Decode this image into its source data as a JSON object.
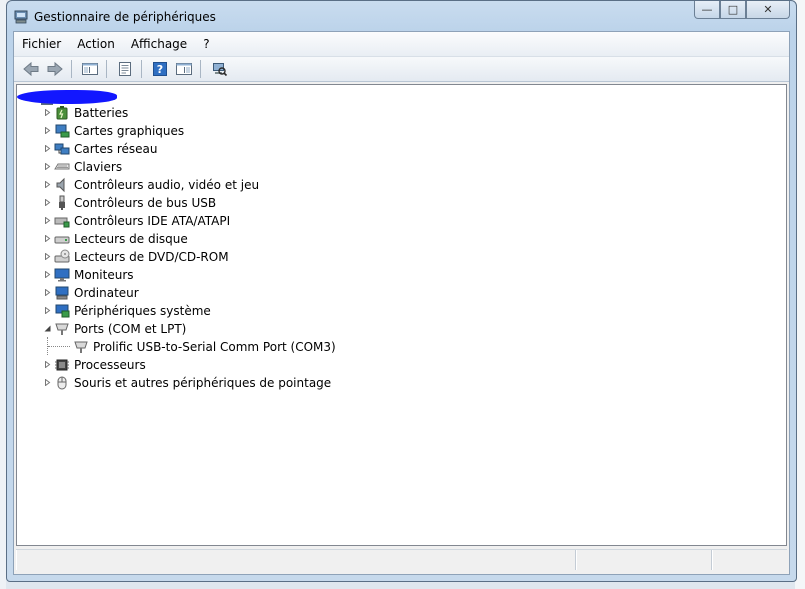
{
  "window": {
    "title": "Gestionnaire de périphériques",
    "minimize_glyph": "—",
    "maximize_glyph": "□",
    "close_glyph": "✕"
  },
  "menu": [
    "Fichier",
    "Action",
    "Affichage",
    "?"
  ],
  "toolbar": {
    "buttons": [
      "back-icon",
      "forward-icon",
      "show-hide-console-tree-icon",
      "properties-icon",
      "help-icon",
      "show-action-pane-icon",
      "scan-hardware-changes-icon"
    ]
  },
  "tree": {
    "nodes": [
      {
        "label": "Batteries",
        "icon": "battery-icon",
        "expanded": false
      },
      {
        "label": "Cartes graphiques",
        "icon": "display-adapter-icon",
        "expanded": false
      },
      {
        "label": "Cartes réseau",
        "icon": "network-adapter-icon",
        "expanded": false
      },
      {
        "label": "Claviers",
        "icon": "keyboard-icon",
        "expanded": false
      },
      {
        "label": "Contrôleurs audio, vidéo et jeu",
        "icon": "speaker-icon",
        "expanded": false
      },
      {
        "label": "Contrôleurs de bus USB",
        "icon": "usb-icon",
        "expanded": false
      },
      {
        "label": "Contrôleurs IDE ATA/ATAPI",
        "icon": "ide-controller-icon",
        "expanded": false
      },
      {
        "label": "Lecteurs de disque",
        "icon": "disk-drive-icon",
        "expanded": false
      },
      {
        "label": "Lecteurs de DVD/CD-ROM",
        "icon": "dvd-drive-icon",
        "expanded": false
      },
      {
        "label": "Moniteurs",
        "icon": "monitor-icon",
        "expanded": false
      },
      {
        "label": "Ordinateur",
        "icon": "computer-icon",
        "expanded": false
      },
      {
        "label": "Périphériques système",
        "icon": "system-device-icon",
        "expanded": false
      },
      {
        "label": "Ports (COM et LPT)",
        "icon": "port-icon",
        "expanded": true
      },
      {
        "label": "Prolific USB-to-Serial Comm Port (COM3)",
        "icon": "port-icon",
        "child": true
      },
      {
        "label": "Processeurs",
        "icon": "processor-icon",
        "expanded": false
      },
      {
        "label": "Souris et autres périphériques de pointage",
        "icon": "mouse-icon",
        "expanded": false
      }
    ]
  },
  "colors": {
    "redaction": "#1217ff",
    "window_frame": "#bcd3ea"
  }
}
